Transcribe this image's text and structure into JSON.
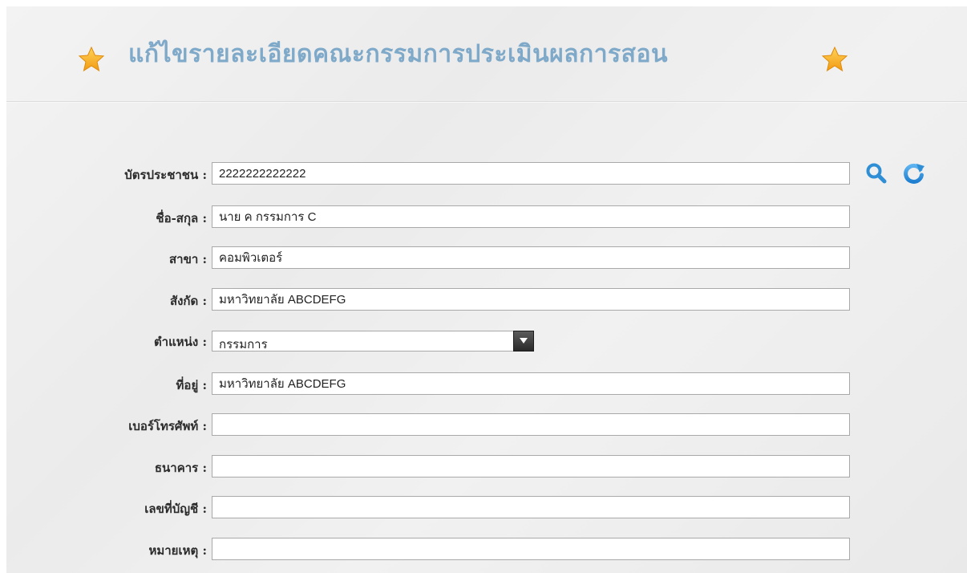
{
  "header": {
    "title": "แก้ไขรายละเอียดคณะกรรมการประเมินผลการสอน",
    "icon": "star-icon",
    "star_color": "#f5b32a"
  },
  "form": {
    "id_card": {
      "label": "บัตรประชาชน :",
      "value": "2222222222222"
    },
    "full_name": {
      "label": "ชื่อ-สกุล :",
      "value": "นาย ค กรรมการ C"
    },
    "major": {
      "label": "สาขา :",
      "value": "คอมพิวเตอร์"
    },
    "affiliation": {
      "label": "สังกัด :",
      "value": "มหาวิทยาลัย ABCDEFG"
    },
    "position": {
      "label": "ตำแหน่ง :",
      "selected": "กรรมการ"
    },
    "address": {
      "label": "ที่อยู่ :",
      "value": "มหาวิทยาลัย ABCDEFG"
    },
    "phone": {
      "label": "เบอร์โทรศัพท์ :",
      "value": ""
    },
    "bank": {
      "label": "ธนาคาร :",
      "value": ""
    },
    "account_no": {
      "label": "เลขที่บัญชี :",
      "value": ""
    },
    "note": {
      "label": "หมายเหตุ :",
      "value": ""
    }
  },
  "actions": {
    "search_icon": "search-icon",
    "refresh_icon": "refresh-icon",
    "accent": "#2f8fd6"
  }
}
